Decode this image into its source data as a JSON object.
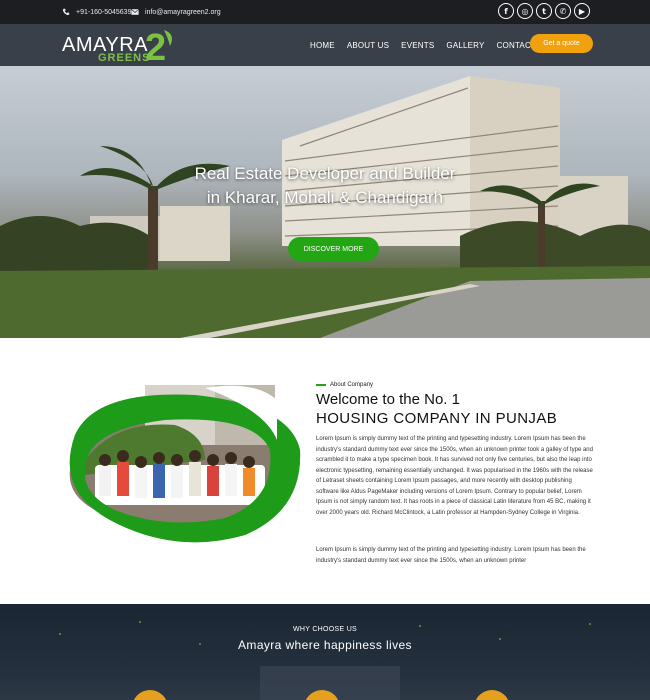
{
  "topbar": {
    "phone": "+91-160-5045639",
    "email": "info@amayragreen2.org",
    "socials": [
      {
        "icon": "facebook-icon",
        "glyph": "f"
      },
      {
        "icon": "instagram-icon",
        "glyph": "◎"
      },
      {
        "icon": "twitter-icon",
        "glyph": "t"
      },
      {
        "icon": "whatsapp-icon",
        "glyph": "✆"
      },
      {
        "icon": "youtube-icon",
        "glyph": "▶"
      }
    ]
  },
  "brand": {
    "logo_line1": "AMAYRA",
    "logo_line2": "GREENS",
    "logo_numeral": "2",
    "accent_green": "#24a614",
    "logo_green": "#7cc242",
    "accent_orange": "#f1a10d"
  },
  "nav": {
    "items": [
      "HOME",
      "ABOUT US",
      "EVENTS",
      "GALLERY",
      "CONTACT US"
    ],
    "cta_label": "Get a quote"
  },
  "hero": {
    "title_line1": "Real Estate Developer and Builder",
    "title_line2": "in Kharar, Mohali & Chandigarh",
    "button_label": "DISCOVER MORE"
  },
  "about": {
    "tag": "About Company",
    "heading_line1": "Welcome to the No. 1",
    "heading_line2": "HOUSING COMPANY IN PUNJAB",
    "paragraph1": "Lorem Ipsum is simply dummy text of the printing and typesetting industry. Lorem Ipsum has been the industry's standard dummy text ever since the 1500s, when an unknown printer took a galley of type and scrambled it to make a type specimen book. It has survived not only five centuries, but also the leap into electronic typesetting, remaining essentially unchanged. It was popularised in the 1960s with the release of Letraset sheets containing Lorem Ipsum passages, and more recently with desktop publishing software like Aldus PageMaker including versions of Lorem Ipsum. Contrary to popular belief, Lorem Ipsum is not simply random text. It has roots in a piece of classical Latin literature from 45 BC, making it over 2000 years old. Richard McClintock, a Latin professor at Hampden-Sydney College in Virginia.",
    "paragraph2": "Lorem Ipsum is simply dummy text of the printing and typesetting industry. Lorem Ipsum has been the industry's standard dummy text ever since the 1500s, when an unknown printer"
  },
  "why": {
    "tag": "WHY CHOOSE US",
    "title": "Amayra where happiness lives"
  }
}
